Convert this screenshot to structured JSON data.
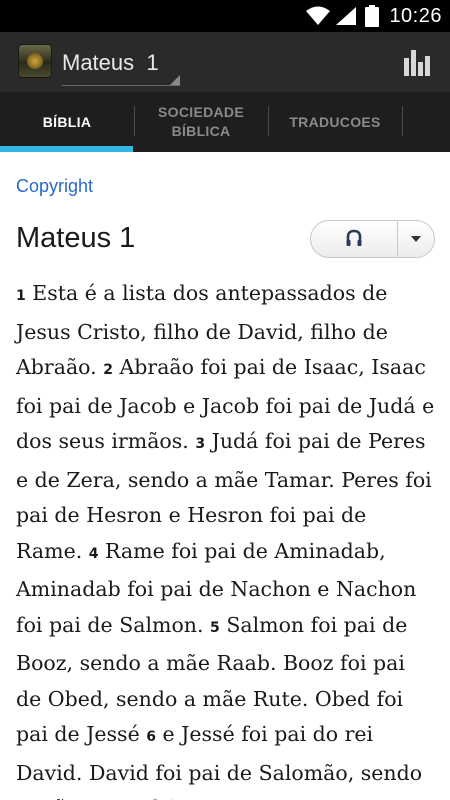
{
  "status_bar": {
    "time": "10:26",
    "icons": [
      "wifi-icon",
      "signal-icon",
      "battery-icon"
    ]
  },
  "action_bar": {
    "book_selector": "Mateus  1",
    "icons": [
      "app-logo",
      "bar-chart-icon"
    ]
  },
  "tabs": [
    {
      "label": "BÍBLIA",
      "active": true
    },
    {
      "label": "SOCIEDADE BÍBLICA",
      "active": false
    },
    {
      "label": "TRADUCOES",
      "active": false
    }
  ],
  "content": {
    "copyright_link": "Copyright",
    "chapter_title": "Mateus 1",
    "audio": {
      "play_icon": "headphones-icon",
      "menu_icon": "dropdown-arrow-icon"
    },
    "verses": [
      {
        "number": "1",
        "text": "Esta é a lista dos antepassados de Jesus Cristo, filho de David, filho de Abraão."
      },
      {
        "number": "2",
        "text": "Abraão foi pai de Isaac, Isaac foi pai de Jacob e Jacob foi pai de Judá e dos seus irmãos."
      },
      {
        "number": "3",
        "text": "Judá foi pai de Peres e de Zera, sendo a mãe Tamar. Peres foi pai de Hesron e Hesron foi pai de Rame."
      },
      {
        "number": "4",
        "text": "Rame foi pai de Aminadab, Aminadab foi pai de Nachon e Nachon foi pai de Salmon."
      },
      {
        "number": "5",
        "text": "Salmon foi pai de Booz, sendo a mãe Raab. Booz foi pai de Obed, sendo a mãe Rute. Obed foi pai de Jessé"
      },
      {
        "number": "6",
        "text": "e Jessé foi pai do rei David. David foi pai de Salomão, sendo a mãe a que foi"
      }
    ]
  },
  "colors": {
    "accent": "#33b5e5",
    "link": "#2a6ac8",
    "action_bar": "#2a2a2a",
    "tab_bar": "#1e1e1e"
  }
}
